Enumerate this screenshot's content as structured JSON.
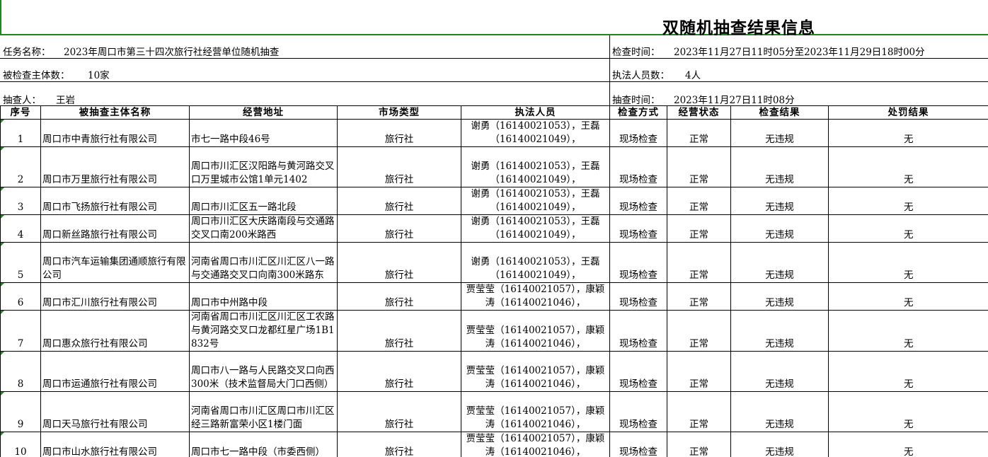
{
  "title": "双随机抽查结果信息",
  "meta": {
    "task_label": "任务名称：",
    "task_value": "2023年周口市第三十四次旅行社经营单位随机抽查",
    "check_time_label": "检查时间：",
    "check_time_value": "2023年11月27日11时05分至2023年11月29日18时00分",
    "subject_count_label": "被检查主体数：",
    "subject_count_value": "10家",
    "officer_count_label": "执法人员数：",
    "officer_count_value": "4人",
    "sampler_label": "抽查人：",
    "sampler_value": "王岩",
    "sample_time_label": "抽查时间：",
    "sample_time_value": "2023年11月27日11时08分"
  },
  "headers": [
    "序号",
    "被抽查主体名称",
    "经营地址",
    "市场类型",
    "执法人员",
    "检查方式",
    "经营状态",
    "检查结果",
    "处罚结果"
  ],
  "rows": [
    {
      "no": "1",
      "name": "周口市中青旅行社有限公司",
      "addr": "市七一路中段46号",
      "type": "旅行社",
      "officers": "谢勇（16140021053），王磊（16140021049），",
      "method": "现场检查",
      "status": "正常",
      "result": "无违规",
      "penalty": "无"
    },
    {
      "no": "2",
      "name": "周口市万里旅行社有限公司",
      "addr": "周口市川汇区汉阳路与黄河路交叉口万里城市公馆1单元1402",
      "type": "旅行社",
      "officers": "谢勇（16140021053），王磊（16140021049），",
      "method": "现场检查",
      "status": "正常",
      "result": "无违规",
      "penalty": "无"
    },
    {
      "no": "3",
      "name": "周口市飞扬旅行社有限公司",
      "addr": "周口市川汇区五一路北段",
      "type": "旅行社",
      "officers": "谢勇（16140021053），王磊（16140021049），",
      "method": "现场检查",
      "status": "正常",
      "result": "无违规",
      "penalty": "无"
    },
    {
      "no": "4",
      "name": "周口新丝路旅行社有限公司",
      "addr": "周口市川汇区大庆路南段与交通路交叉口南200米路西",
      "type": "旅行社",
      "officers": "谢勇（16140021053），王磊（16140021049），",
      "method": "现场检查",
      "status": "正常",
      "result": "无违规",
      "penalty": "无"
    },
    {
      "no": "5",
      "name": "周口市汽车运输集团通顺旅行有限公司",
      "addr": "河南省周口市川汇区川汇区八一路与交通路交叉口向南300米路东",
      "type": "旅行社",
      "officers": "谢勇（16140021053），王磊（16140021049），",
      "method": "现场检查",
      "status": "正常",
      "result": "无违规",
      "penalty": "无"
    },
    {
      "no": "6",
      "name": "周口市汇川旅行社有限公司",
      "addr": "周口市中州路中段",
      "type": "旅行社",
      "officers": "贾莹莹（16140021057），康颖涛（16140021046），",
      "method": "现场检查",
      "status": "正常",
      "result": "无违规",
      "penalty": "无"
    },
    {
      "no": "7",
      "name": "周口惠众旅行社有限公司",
      "addr": "河南省周口市川汇区川汇区工农路与黄河路交叉口龙都红星广场1B1832号",
      "type": "旅行社",
      "officers": "贾莹莹（16140021057），康颖涛（16140021046），",
      "method": "现场检查",
      "status": "正常",
      "result": "无违规",
      "penalty": "无"
    },
    {
      "no": "8",
      "name": "周口市运通旅行社有限公司",
      "addr": "周口市八一路与人民路交叉口向西300米（技术监督局大门口西侧）",
      "type": "旅行社",
      "officers": "贾莹莹（16140021057），康颖涛（16140021046），",
      "method": "现场检查",
      "status": "正常",
      "result": "无违规",
      "penalty": "无"
    },
    {
      "no": "9",
      "name": "周口天马旅行社有限公司",
      "addr": "河南省周口市川汇区周口市川汇区经三路新富荣小区1楼门面",
      "type": "旅行社",
      "officers": "贾莹莹（16140021057），康颖涛（16140021046），",
      "method": "现场检查",
      "status": "正常",
      "result": "无违规",
      "penalty": "无"
    },
    {
      "no": "10",
      "name": "周口市山水旅行社有限公司",
      "addr": "周口市七一路中段（市委西侧）",
      "type": "旅行社",
      "officers": "贾莹莹（16140021057），康颖涛（16140021046），",
      "method": "现场检查",
      "status": "正常",
      "result": "无违规",
      "penalty": "无"
    }
  ]
}
